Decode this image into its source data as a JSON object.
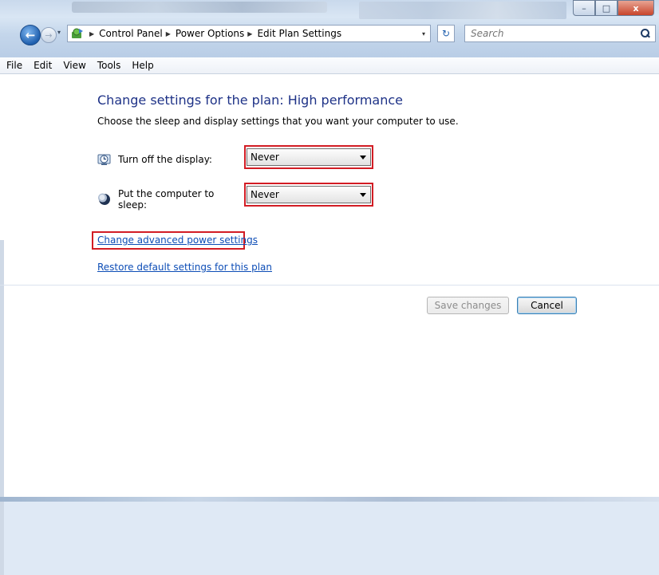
{
  "window": {
    "buttons": {
      "minimize": "–",
      "maximize": "□",
      "close": "x"
    }
  },
  "nav": {
    "back_glyph": "←",
    "forward_glyph": "→",
    "dropdown_glyph": "▾",
    "refresh_glyph": "↻",
    "breadcrumb": [
      "Control Panel",
      "Power Options",
      "Edit Plan Settings"
    ],
    "search_placeholder": "Search"
  },
  "menu": [
    "File",
    "Edit",
    "View",
    "Tools",
    "Help"
  ],
  "main": {
    "heading": "Change settings for the plan: High performance",
    "subheading": "Choose the sleep and display settings that you want your computer to use.",
    "settings": [
      {
        "label": "Turn off the display:",
        "value": "Never",
        "icon": "display-clock-icon"
      },
      {
        "label": "Put the computer to sleep:",
        "value": "Never",
        "icon": "sleep-moon-icon"
      }
    ],
    "links": {
      "advanced": "Change advanced power settings",
      "restore": "Restore default settings for this plan"
    },
    "buttons": {
      "save": "Save changes",
      "cancel": "Cancel"
    }
  },
  "colors": {
    "highlight": "#d21c24",
    "link": "#0d4db6",
    "heading": "#1e3287"
  }
}
